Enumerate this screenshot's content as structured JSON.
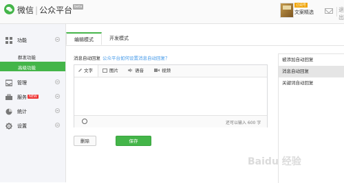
{
  "header": {
    "brand_wechat": "微信",
    "brand_divider": "|",
    "brand_platform": "公众平台",
    "beta_badge": "beta",
    "level_badge": "订阅号",
    "account_name": "文案精选",
    "logout": "退出"
  },
  "sidebar": {
    "sections": [
      {
        "label": "功能",
        "icon": "grid-icon"
      },
      {
        "label": "管理",
        "icon": "inbox-icon"
      },
      {
        "label": "服务",
        "icon": "briefcase-icon",
        "badge": "NEW"
      },
      {
        "label": "统计",
        "icon": "pie-chart-icon"
      },
      {
        "label": "设置",
        "icon": "gear-icon"
      }
    ],
    "sub_items": [
      "群发功能",
      "高级功能"
    ],
    "active_sub": "高级功能"
  },
  "tabs": [
    "编辑模式",
    "开发模式"
  ],
  "active_tab": "编辑模式",
  "main": {
    "hint_label": "消息自动回复",
    "hint_link": "公众平台如何设置消息自动回复？",
    "editor_tools": [
      "文字",
      "图片",
      "语音",
      "视频"
    ],
    "active_tool": "文字",
    "char_remaining": "还可以输入 600 字",
    "delete_button": "删除",
    "save_button": "保存"
  },
  "right_panel": {
    "items": [
      "被添加自动回复",
      "消息自动回复",
      "关键词自动回复"
    ],
    "active": "消息自动回复"
  },
  "watermark": "Baidu 经验",
  "colors": {
    "accent": "#44b549",
    "link": "#459ae9",
    "new_badge": "#ee3333"
  }
}
